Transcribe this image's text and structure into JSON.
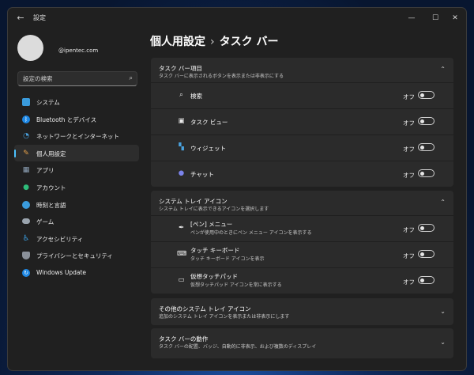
{
  "window": {
    "app_title": "設定",
    "back_icon": "back-arrow-icon",
    "minimize_icon": "minimize-icon",
    "maximize_icon": "maximize-icon",
    "close_icon": "close-icon"
  },
  "account": {
    "email": "@ipentec.com"
  },
  "search": {
    "placeholder": "設定の検索"
  },
  "sidebar": {
    "items": [
      {
        "label": "システム",
        "icon": "system-icon",
        "color": "#3a9bdc"
      },
      {
        "label": "Bluetooth とデバイス",
        "icon": "bluetooth-icon",
        "color": "#1e88e5"
      },
      {
        "label": "ネットワークとインターネット",
        "icon": "network-icon",
        "color": "#4aa3e0"
      },
      {
        "label": "個人用設定",
        "icon": "brush-icon",
        "color": "#e8a24a",
        "selected": true
      },
      {
        "label": "アプリ",
        "icon": "apps-icon",
        "color": "#8fa3b8"
      },
      {
        "label": "アカウント",
        "icon": "account-icon",
        "color": "#2ebc7a"
      },
      {
        "label": "時刻と言語",
        "icon": "globe-clock-icon",
        "color": "#3a9bdc"
      },
      {
        "label": "ゲーム",
        "icon": "game-controller-icon",
        "color": "#9aa4ae"
      },
      {
        "label": "アクセシビリティ",
        "icon": "accessibility-icon",
        "color": "#3a9bdc"
      },
      {
        "label": "プライバシーとセキュリティ",
        "icon": "shield-icon",
        "color": "#8a9099"
      },
      {
        "label": "Windows Update",
        "icon": "windows-update-icon",
        "color": "#1e88e5"
      }
    ]
  },
  "breadcrumb": {
    "parent": "個人用設定",
    "separator": "›",
    "current": "タスク バー"
  },
  "sections": {
    "taskbar_items": {
      "title": "タスク バー項目",
      "subtitle": "タスク バーに表示されるボタンを表示または非表示にする",
      "expanded": true,
      "rows": [
        {
          "label": "検索",
          "icon": "search-icon",
          "state": "オフ"
        },
        {
          "label": "タスク ビュー",
          "icon": "task-view-icon",
          "state": "オフ"
        },
        {
          "label": "ウィジェット",
          "icon": "widgets-icon",
          "state": "オフ"
        },
        {
          "label": "チャット",
          "icon": "chat-icon",
          "state": "オフ"
        }
      ]
    },
    "tray_icons": {
      "title": "システム トレイ アイコン",
      "subtitle": "システム トレイに表示できるアイコンを選択します",
      "expanded": true,
      "rows": [
        {
          "label": "[ペン] メニュー",
          "sub": "ペンが使用中のときにペン メニュー アイコンを表示する",
          "icon": "pen-icon",
          "state": "オフ"
        },
        {
          "label": "タッチ キーボード",
          "sub": "タッチ キーボード アイコンを表示",
          "icon": "keyboard-icon",
          "state": "オフ"
        },
        {
          "label": "仮想タッチパッド",
          "sub": "仮想タッチパッド アイコンを常に表示する",
          "icon": "touchpad-icon",
          "state": "オフ"
        }
      ]
    },
    "other_tray": {
      "title": "その他のシステム トレイ アイコン",
      "subtitle": "追加のシステム トレイ アイコンを表示または非表示にします",
      "expanded": false
    },
    "behaviors": {
      "title": "タスク バーの動作",
      "subtitle": "タスク バーの配置、バッジ、自動的に非表示、および複数のディスプレイ",
      "expanded": false
    }
  }
}
